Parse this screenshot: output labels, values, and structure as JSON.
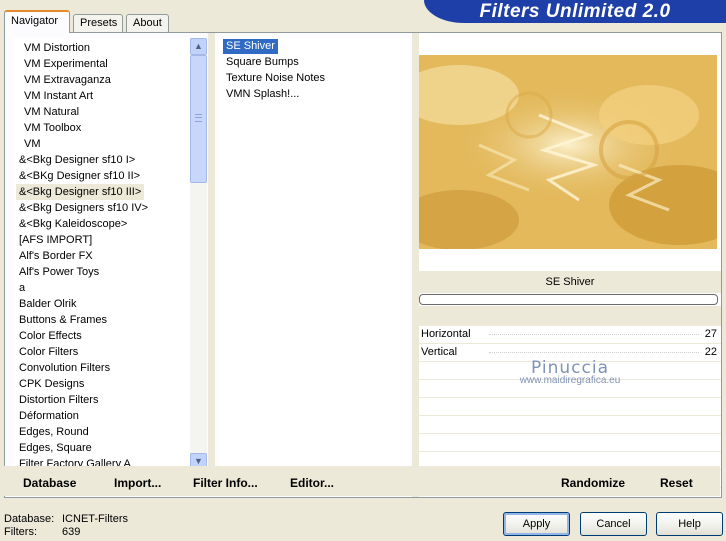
{
  "app": {
    "title": "Filters Unlimited 2.0"
  },
  "tabs": [
    {
      "label": "Navigator",
      "active": true
    },
    {
      "label": "Presets",
      "active": false
    },
    {
      "label": "About",
      "active": false
    }
  ],
  "categories": {
    "items": [
      "VM Distortion",
      "VM Experimental",
      "VM Extravaganza",
      "VM Instant Art",
      "VM Natural",
      "VM Toolbox",
      "VM",
      "&<Bkg Designer sf10 I>",
      "&<BKg Designer sf10 II>",
      "&<Bkg Designer sf10 III>",
      "&<Bkg Designers sf10 IV>",
      "&<Bkg Kaleidoscope>",
      "[AFS IMPORT]",
      "Alf's Border FX",
      "Alf's Power Toys",
      "a",
      "Balder Olrik",
      "Buttons & Frames",
      "Color Effects",
      "Color Filters",
      "Convolution Filters",
      "CPK Designs",
      "Distortion Filters",
      "Déformation",
      "Edges, Round",
      "Edges, Square",
      "Filter Factory Gallery A"
    ],
    "selected": "&<Bkg Designer sf10 III>"
  },
  "filters": {
    "items": [
      "SE Shiver",
      "Square Bumps",
      "Texture Noise Notes",
      "VMN Splash!..."
    ],
    "selected": "SE Shiver"
  },
  "preview": {
    "filter_name": "SE Shiver",
    "progress": 0.0,
    "colors": {
      "light": "#f6e3ab",
      "mid": "#e0b350",
      "dark": "#c08a22"
    }
  },
  "params": [
    {
      "label": "Horizontal",
      "value": "27"
    },
    {
      "label": "Vertical",
      "value": "22"
    }
  ],
  "watermark": {
    "title": "Pinuccia",
    "url": "www.maidiregrafica.eu"
  },
  "bottom_bar": {
    "database": {
      "label": "Database"
    },
    "import": {
      "label": "Import..."
    },
    "filter_info": {
      "label": "Filter Info..."
    },
    "editor": {
      "label": "Editor..."
    },
    "randomize": {
      "label": "Randomize"
    },
    "reset": {
      "label": "Reset"
    }
  },
  "status": {
    "database_label": "Database:",
    "database_value": "ICNET-Filters",
    "filters_label": "Filters:",
    "filters_value": "639"
  },
  "buttons": {
    "apply": "Apply",
    "cancel": "Cancel",
    "help": "Help"
  }
}
